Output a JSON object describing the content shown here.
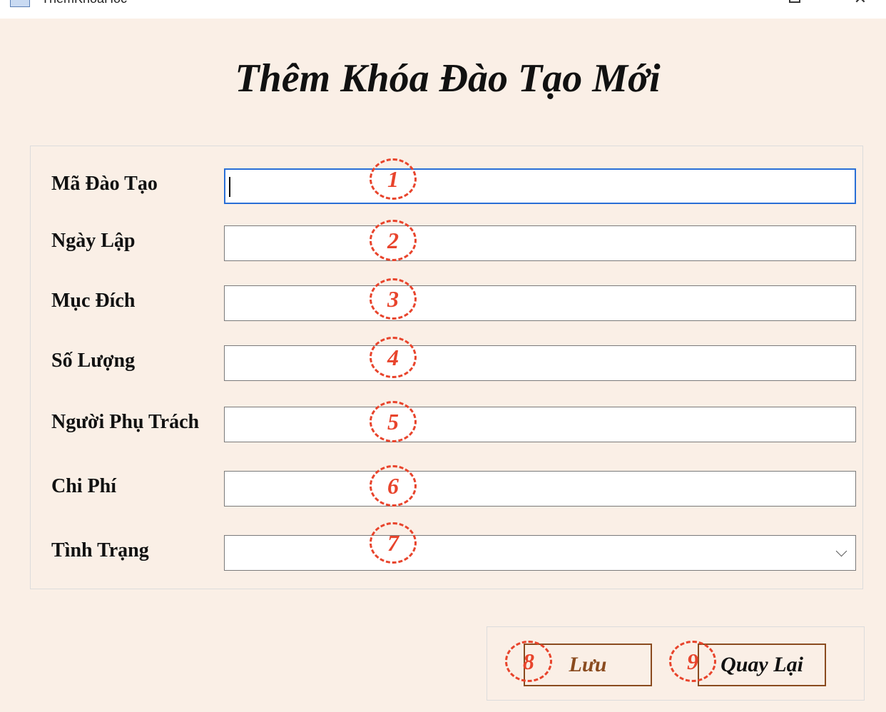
{
  "window": {
    "title": "ThemKhoaHoc",
    "maximize_icon": "maximize-icon",
    "close_icon": "close-icon",
    "close_glyph": "✕"
  },
  "form": {
    "heading": "Thêm Khóa Đào Tạo Mới",
    "fields": [
      {
        "label": "Mã Đào Tạo",
        "value": "",
        "badge": "1"
      },
      {
        "label": "Ngày Lập",
        "value": "",
        "badge": "2"
      },
      {
        "label": "Mục Đích",
        "value": "",
        "badge": "3"
      },
      {
        "label": "Số Lượng",
        "value": "",
        "badge": "4"
      },
      {
        "label": "Người Phụ Trách",
        "value": "",
        "badge": "5"
      },
      {
        "label": "Chi Phí",
        "value": "",
        "badge": "6"
      },
      {
        "label": "Tình Trạng",
        "value": "",
        "badge": "7",
        "control": "dropdown"
      }
    ]
  },
  "actions": {
    "save_label": "Lưu",
    "save_badge": "8",
    "back_label": "Quay Lại",
    "back_badge": "9"
  },
  "colors": {
    "background": "#faefe6",
    "badge": "#e8442c",
    "focus_border": "#2a6fd6",
    "button_border": "#8a4b1f"
  }
}
